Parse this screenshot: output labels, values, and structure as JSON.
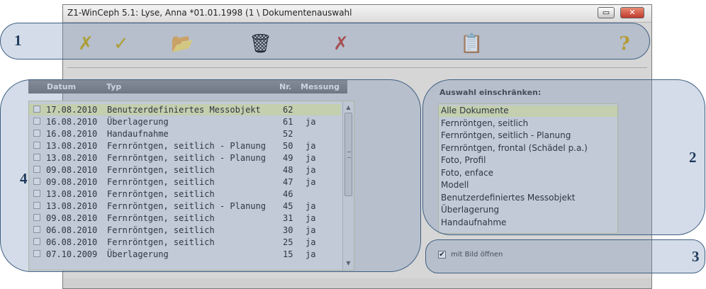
{
  "window": {
    "title": "Z1-WinCeph 5.1: Lyse, Anna *01.01.1998 (1 \\ Dokumentenauswahl",
    "minimize_glyph": "▭",
    "close_glyph": "✕"
  },
  "toolbar": {
    "cancel_icon": "✗",
    "ok_icon": "✓",
    "open_icon": "📂",
    "delete_icon": "🗑",
    "reject_icon": "✗",
    "copy_icon": "📋",
    "help_icon": "?"
  },
  "list": {
    "columns": {
      "date": "Datum",
      "type": "Typ",
      "nr": "Nr.",
      "measure": "Messung"
    },
    "rows": [
      {
        "date": "17.08.2010",
        "type": "Benutzerdefiniertes Messobjekt",
        "nr": "62",
        "measure": "",
        "selected": true
      },
      {
        "date": "16.08.2010",
        "type": "Überlagerung",
        "nr": "61",
        "measure": "ja"
      },
      {
        "date": "16.08.2010",
        "type": "Handaufnahme",
        "nr": "52",
        "measure": ""
      },
      {
        "date": "13.08.2010",
        "type": "Fernröntgen, seitlich - Planung",
        "nr": "50",
        "measure": "ja"
      },
      {
        "date": "13.08.2010",
        "type": "Fernröntgen, seitlich - Planung",
        "nr": "49",
        "measure": "ja"
      },
      {
        "date": "09.08.2010",
        "type": "Fernröntgen, seitlich",
        "nr": "48",
        "measure": "ja"
      },
      {
        "date": "09.08.2010",
        "type": "Fernröntgen, seitlich",
        "nr": "47",
        "measure": "ja"
      },
      {
        "date": "13.08.2010",
        "type": "Fernröntgen, seitlich",
        "nr": "46",
        "measure": ""
      },
      {
        "date": "13.08.2010",
        "type": "Fernröntgen, seitlich - Planung",
        "nr": "45",
        "measure": "ja"
      },
      {
        "date": "09.08.2010",
        "type": "Fernröntgen, seitlich",
        "nr": "31",
        "measure": "ja"
      },
      {
        "date": "06.08.2010",
        "type": "Fernröntgen, seitlich",
        "nr": "30",
        "measure": "ja"
      },
      {
        "date": "06.08.2010",
        "type": "Fernröntgen, seitlich",
        "nr": "25",
        "measure": "ja"
      },
      {
        "date": "07.10.2009",
        "type": "Überlagerung",
        "nr": "15",
        "measure": "ja"
      }
    ]
  },
  "filter": {
    "label": "Auswahl einschränken:",
    "items": [
      {
        "label": "Alle Dokumente",
        "selected": true
      },
      {
        "label": "Fernröntgen, seitlich"
      },
      {
        "label": "Fernröntgen, seitlich - Planung"
      },
      {
        "label": "Fernröntgen, frontal (Schädel p.a.)"
      },
      {
        "label": "Foto, Profil"
      },
      {
        "label": "Foto, enface"
      },
      {
        "label": "Modell"
      },
      {
        "label": "Benutzerdefiniertes Messobjekt"
      },
      {
        "label": "Überlagerung"
      },
      {
        "label": "Handaufnahme"
      }
    ]
  },
  "open_with_image": {
    "label": "mit Bild öffnen",
    "checked": true,
    "check_glyph": "✔"
  },
  "callouts": [
    "1",
    "2",
    "3",
    "4"
  ],
  "colors": {
    "callout_border": "#3f5f83",
    "selection": "#e9ecad",
    "header": "#7a7a7a"
  }
}
